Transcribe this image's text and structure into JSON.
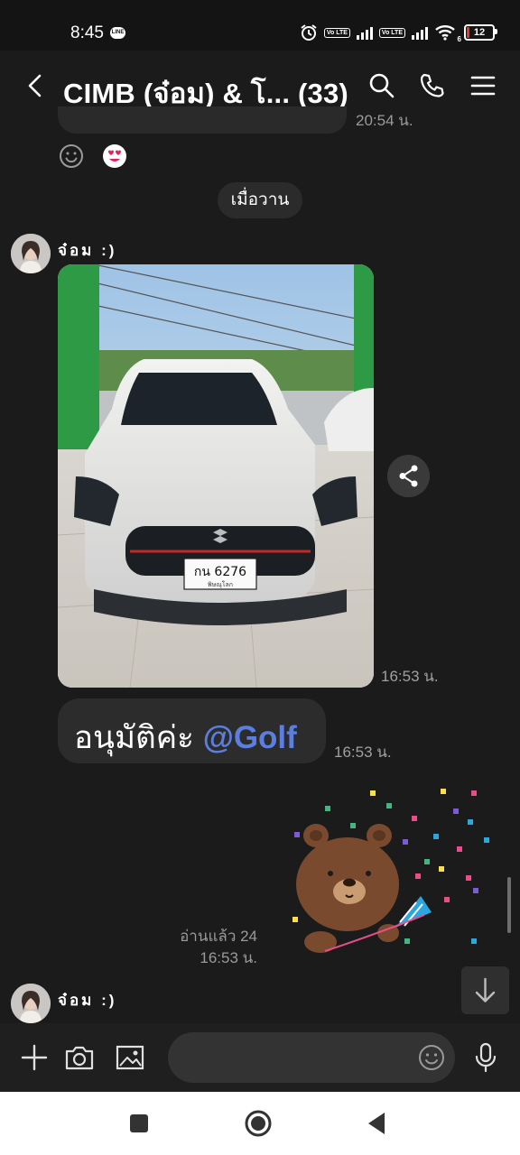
{
  "status_bar": {
    "time": "8:45",
    "line_badge": "LINE",
    "volte_1": "Vo LTE",
    "volte_2": "Vo LTE",
    "wifi_badge": "6",
    "battery": "12"
  },
  "header": {
    "title": "CIMB (จ๋อม) & โ... (33)",
    "icons": [
      "back-arrow-icon",
      "search-icon",
      "phone-icon",
      "menu-icon"
    ]
  },
  "previous": {
    "time": "20:54 น."
  },
  "date_chip": "เมื่อวาน",
  "messages": [
    {
      "sender": "จ๋อม :)",
      "type": "photo",
      "time": "16:53 น.",
      "plate": "กน 6276",
      "plate_province": "พิษณุโลก"
    },
    {
      "type": "text",
      "text": "อนุมัติค่ะ",
      "mention": "@Golf",
      "time": "16:53 น."
    },
    {
      "type": "sticker",
      "sticker": "brown-bear-party-popper",
      "read": "อ่านแล้ว 24",
      "time": "16:53 น."
    },
    {
      "sender": "จ๋อม :)"
    }
  ],
  "input": {
    "placeholder": ""
  },
  "colors": {
    "background": "#1b1b1b",
    "bubble": "#2c2c2c",
    "mention": "#5b7fe0",
    "time_text": "#a0a0a0"
  }
}
